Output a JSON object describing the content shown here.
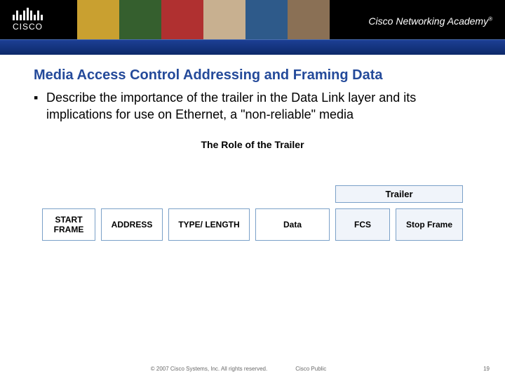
{
  "banner": {
    "brand": "CISCO",
    "academy_prefix": "Cisco ",
    "academy_main": "Networking Academy",
    "tm": "®"
  },
  "title": "Media Access Control Addressing and Framing Data",
  "bullet_marker": "▪",
  "bullet_text": "Describe the importance of the trailer in the Data Link layer and its implications for use on Ethernet, a \"non-reliable\" media",
  "subhead": "The Role of the Trailer",
  "trailer_label": "Trailer",
  "fields": {
    "start": "START FRAME",
    "address": "ADDRESS",
    "type": "TYPE/ LENGTH",
    "data": "Data",
    "fcs": "FCS",
    "stop": "Stop Frame"
  },
  "footer": {
    "copyright": "© 2007 Cisco Systems, Inc. All rights reserved.",
    "public": "Cisco Public",
    "page": "19"
  },
  "photo_colors": [
    "#c9a030",
    "#355f2e",
    "#b03030",
    "#c8b090",
    "#2e5a8a",
    "#8a7055"
  ]
}
